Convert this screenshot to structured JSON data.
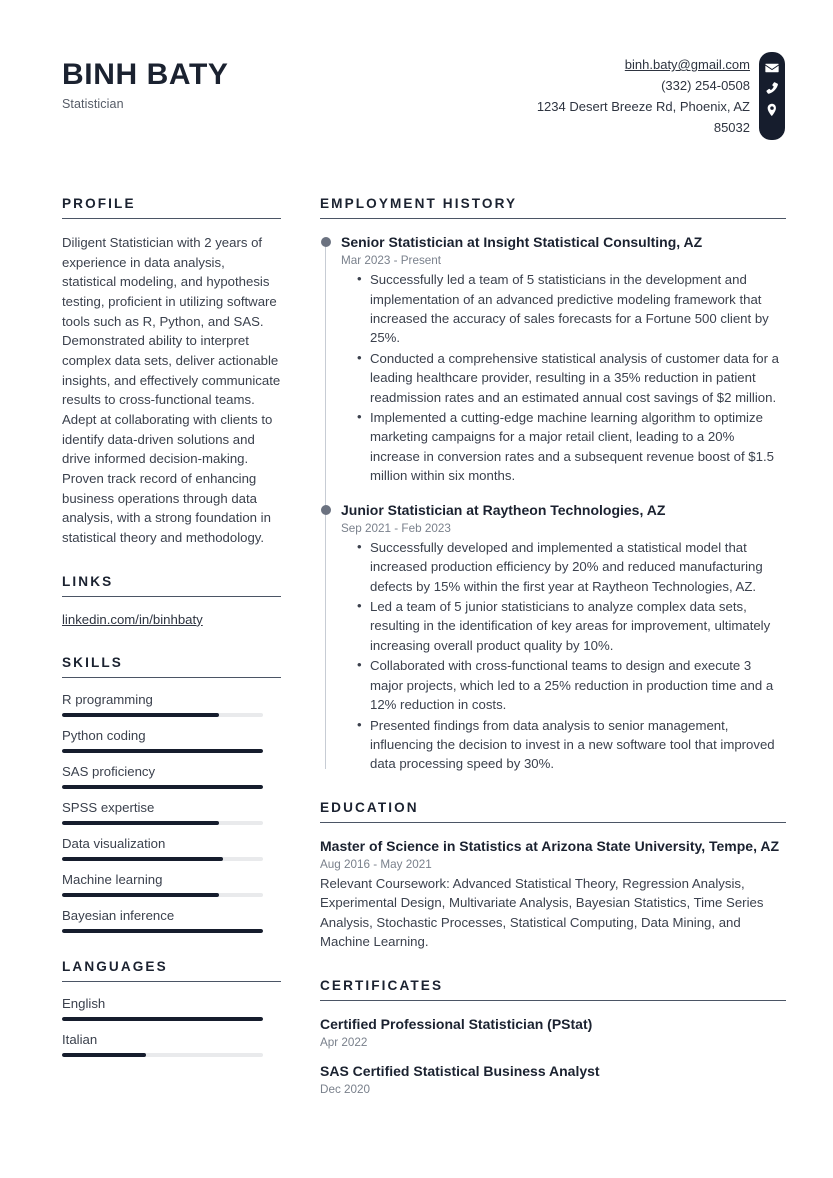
{
  "header": {
    "full_name": "BINH BATY",
    "job_title": "Statistician",
    "contact": {
      "email": "binh.baty@gmail.com",
      "phone": "(332) 254-0508",
      "address_line1": "1234 Desert Breeze Rd, Phoenix, AZ",
      "address_line2": "85032"
    },
    "icons": [
      "envelope-icon",
      "phone-icon",
      "location-pin-icon"
    ]
  },
  "colors": {
    "ink": "#1b2230",
    "body_text": "#3b414d",
    "muted": "#7a818c",
    "rule": "#4b5565",
    "accent_dark": "#161d2d",
    "meter_track": "#e9eaec",
    "timeline_dot": "#6b7280",
    "timeline_axis": "#c7ccd4"
  },
  "left_column": {
    "profile": {
      "title": "PROFILE",
      "text": "Diligent Statistician with 2 years of experience in data analysis, statistical modeling, and hypothesis testing, proficient in utilizing software tools such as R, Python, and SAS. Demonstrated ability to interpret complex data sets, deliver actionable insights, and effectively communicate results to cross-functional teams. Adept at collaborating with clients to identify data-driven solutions and drive informed decision-making. Proven track record of enhancing business operations through data analysis, with a strong foundation in statistical theory and methodology."
    },
    "links": {
      "title": "LINKS",
      "items": [
        {
          "label": "linkedin.com/in/binhbaty"
        }
      ]
    },
    "skills": {
      "title": "SKILLS",
      "items": [
        {
          "label": "R programming",
          "level": 78
        },
        {
          "label": "Python coding",
          "level": 100
        },
        {
          "label": "SAS proficiency",
          "level": 100
        },
        {
          "label": "SPSS expertise",
          "level": 78
        },
        {
          "label": "Data visualization",
          "level": 80
        },
        {
          "label": "Machine learning",
          "level": 78
        },
        {
          "label": "Bayesian inference",
          "level": 100
        }
      ]
    },
    "languages": {
      "title": "LANGUAGES",
      "items": [
        {
          "label": "English",
          "level": 100
        },
        {
          "label": "Italian",
          "level": 42
        }
      ]
    }
  },
  "right_column": {
    "employment": {
      "title": "EMPLOYMENT HISTORY",
      "jobs": [
        {
          "role": "Senior Statistician at Insight Statistical Consulting, AZ",
          "dates": "Mar 2023 - Present",
          "bullets": [
            "Successfully led a team of 5 statisticians in the development and implementation of an advanced predictive modeling framework that increased the accuracy of sales forecasts for a Fortune 500 client by 25%.",
            "Conducted a comprehensive statistical analysis of customer data for a leading healthcare provider, resulting in a 35% reduction in patient readmission rates and an estimated annual cost savings of $2 million.",
            "Implemented a cutting-edge machine learning algorithm to optimize marketing campaigns for a major retail client, leading to a 20% increase in conversion rates and a subsequent revenue boost of $1.5 million within six months."
          ]
        },
        {
          "role": "Junior Statistician at Raytheon Technologies, AZ",
          "dates": "Sep 2021 - Feb 2023",
          "bullets": [
            "Successfully developed and implemented a statistical model that increased production efficiency by 20% and reduced manufacturing defects by 15% within the first year at Raytheon Technologies, AZ.",
            "Led a team of 5 junior statisticians to analyze complex data sets, resulting in the identification of key areas for improvement, ultimately increasing overall product quality by 10%.",
            "Collaborated with cross-functional teams to design and execute 3 major projects, which led to a 25% reduction in production time and a 12% reduction in costs.",
            "Presented findings from data analysis to senior management, influencing the decision to invest in a new software tool that improved data processing speed by 30%."
          ]
        }
      ]
    },
    "education": {
      "title": "EDUCATION",
      "entries": [
        {
          "title": "Master of Science in Statistics at Arizona State University, Tempe, AZ",
          "dates": "Aug 2016 - May 2021",
          "description": "Relevant Coursework: Advanced Statistical Theory, Regression Analysis, Experimental Design, Multivariate Analysis, Bayesian Statistics, Time Series Analysis, Stochastic Processes, Statistical Computing, Data Mining, and Machine Learning."
        }
      ]
    },
    "certificates": {
      "title": "CERTIFICATES",
      "entries": [
        {
          "title": "Certified Professional Statistician (PStat)",
          "dates": "Apr 2022"
        },
        {
          "title": "SAS Certified Statistical Business Analyst",
          "dates": "Dec 2020"
        }
      ]
    }
  }
}
